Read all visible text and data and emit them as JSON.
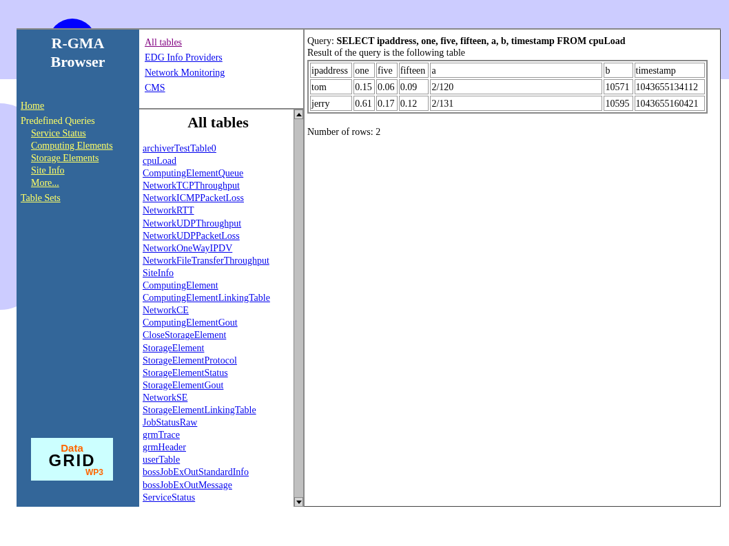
{
  "sidebar": {
    "title": [
      "R-GMA",
      "Browser"
    ],
    "nav": [
      {
        "label": "Home",
        "link": true
      },
      {
        "label": "Predefined Queries",
        "link": false,
        "children": [
          {
            "label": "Service Status"
          },
          {
            "label": "Computing Elements"
          },
          {
            "label": "Storage Elements"
          },
          {
            "label": "Site Info"
          },
          {
            "label": "More..."
          }
        ]
      },
      {
        "label": "Table Sets",
        "link": true
      }
    ],
    "logo": {
      "top": "Data",
      "middle": "GRID",
      "bottom": "WP3"
    }
  },
  "table_sets": [
    {
      "label": "All tables",
      "visited": true
    },
    {
      "label": "EDG Info Providers",
      "visited": false
    },
    {
      "label": "Network Monitoring",
      "visited": false
    },
    {
      "label": "CMS",
      "visited": false
    }
  ],
  "tables_panel": {
    "heading": "All tables",
    "items": [
      "archiverTestTable0",
      "cpuLoad",
      "ComputingElementQueue",
      "NetworkTCPThroughput",
      "NetworkICMPPacketLoss",
      "NetworkRTT",
      "NetworkUDPThroughput",
      "NetworkUDPPacketLoss",
      "NetworkOneWayIPDV",
      "NetworkFileTransferThroughput",
      "SiteInfo",
      "ComputingElement",
      "ComputingElementLinkingTable",
      "NetworkCE",
      "ComputingElementGout",
      "CloseStorageElement",
      "StorageElement",
      "StorageElementProtocol",
      "StorageElementStatus",
      "StorageElementGout",
      "NetworkSE",
      "StorageElementLinkingTable",
      "JobStatusRaw",
      "grmTrace",
      "grmHeader",
      "userTable",
      "bossJobExOutStandardInfo",
      "bossJobExOutMessage",
      "ServiceStatus"
    ]
  },
  "result": {
    "query_label": "Query:",
    "query": "SELECT ipaddress, one, five, fifteen, a, b, timestamp FROM cpuLoad",
    "caption": "Result of the query is the following table",
    "columns": [
      "ipaddress",
      "one",
      "five",
      "fifteen",
      "a",
      "b",
      "timestamp"
    ],
    "rows": [
      [
        "tom",
        "0.15",
        "0.06",
        "0.09",
        "2/120",
        "10571",
        "1043655134112"
      ],
      [
        "jerry",
        "0.61",
        "0.17",
        "0.12",
        "2/131",
        "10595",
        "1043655160421"
      ]
    ],
    "row_count": "Number of rows: 2"
  }
}
